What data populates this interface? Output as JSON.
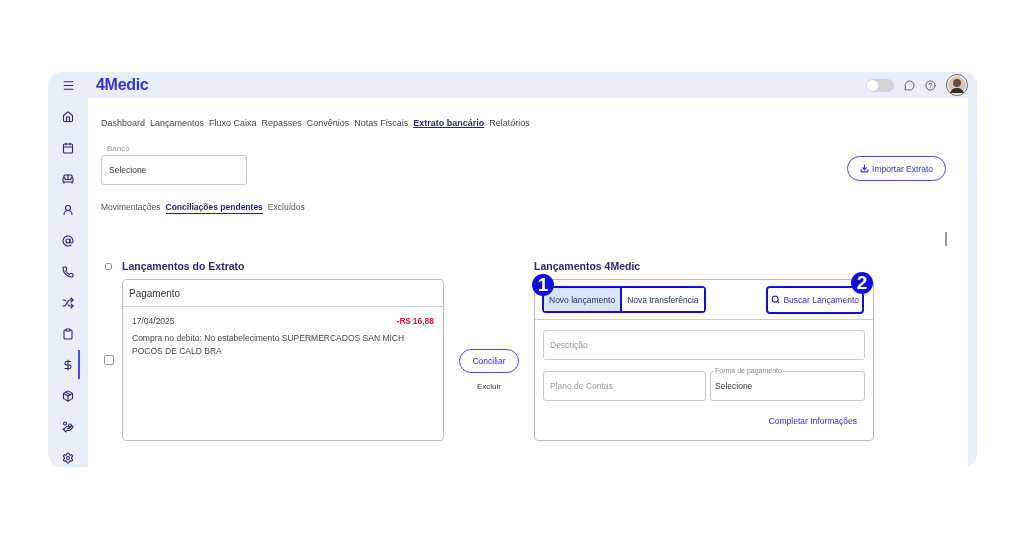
{
  "header": {
    "logo": "4Medic",
    "theme_toggle": {
      "on": false
    }
  },
  "sidebar": {
    "items": [
      {
        "kind": "home",
        "selected": false
      },
      {
        "kind": "calendar",
        "selected": false
      },
      {
        "kind": "sofa",
        "selected": false
      },
      {
        "kind": "user",
        "selected": false
      },
      {
        "kind": "at",
        "selected": false
      },
      {
        "kind": "phone",
        "selected": false
      },
      {
        "kind": "shuffle",
        "selected": false
      },
      {
        "kind": "clipboard",
        "selected": false
      },
      {
        "kind": "dollar",
        "selected": true
      },
      {
        "kind": "box",
        "selected": false
      },
      {
        "kind": "hand",
        "selected": false
      },
      {
        "kind": "settings",
        "selected": false
      }
    ]
  },
  "nav": {
    "tabs": [
      {
        "label": "Dashboard",
        "selected": false
      },
      {
        "label": "Lançamentos",
        "selected": false
      },
      {
        "label": "Fluxo Caixa",
        "selected": false
      },
      {
        "label": "Repasses",
        "selected": false
      },
      {
        "label": "Convênios",
        "selected": false
      },
      {
        "label": "Notas Fiscais",
        "selected": false
      },
      {
        "label": "Extrato bancário",
        "selected": true
      },
      {
        "label": "Relatórios",
        "selected": false
      }
    ]
  },
  "bank": {
    "label": "Banco",
    "value": "Selecione"
  },
  "import_button": "Importar Extrato",
  "subtabs": [
    {
      "label": "Movimentações",
      "selected": false
    },
    {
      "label": "Conciliações pendentes",
      "selected": true
    },
    {
      "label": "Excluídos",
      "selected": false
    }
  ],
  "statement": {
    "title": "Lançamentos do Extrato",
    "select_all": {
      "checked": false
    },
    "entries": [
      {
        "type": "Pagamento",
        "date": "17/04/2025",
        "amount": "-R$ 16,88",
        "description": "Compra no debito: No estabelecimento SUPERMERCADOS SAN MICH\nPOCOS DE CALD BRA",
        "checked": false
      }
    ]
  },
  "actions": {
    "reconcile": "Conciliar",
    "delete": "Excluir"
  },
  "system": {
    "title": "Lançamentos 4Medic",
    "tabs": [
      {
        "label": "Novo lançamento",
        "selected": true
      },
      {
        "label": "Nova transferência",
        "selected": false
      }
    ],
    "search_button": "Buscar Lançamento",
    "description": {
      "placeholder": "Descrição"
    },
    "account_plan": {
      "placeholder": "Plano de Contas"
    },
    "payment": {
      "label": "Forma de pagamento",
      "value": "Selecione"
    },
    "complete_link": "Completar Informações"
  },
  "annotations": [
    {
      "label": "1"
    },
    {
      "label": "2"
    }
  ]
}
